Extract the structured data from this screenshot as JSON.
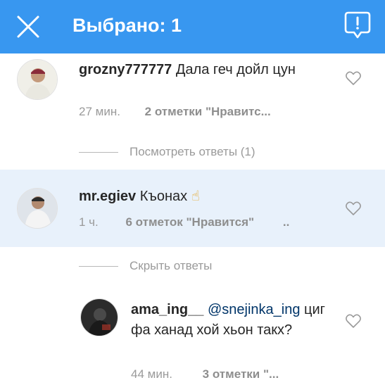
{
  "header": {
    "title": "Выбрано: 1"
  },
  "comments": [
    {
      "username": "grozny777777",
      "text": "Дала геч дойл цун",
      "time": "27 мин.",
      "likes": "2 отметки \"Нравитс...",
      "replies_toggle": "Посмотреть ответы (1)"
    },
    {
      "username": "mr.egiev",
      "text": "Къонах",
      "emoji": "☝",
      "time": "1 ч.",
      "likes": "6 отметок \"Нравится\"",
      "more": "..",
      "replies_toggle": "Скрыть ответы",
      "selected": true
    },
    {
      "username": "ama_ing__",
      "mention": "@snejinka_ing",
      "text": "циг фа ханад хой хьон такх?",
      "time": "44 мин.",
      "likes": "3 отметки \"..."
    }
  ],
  "colors": {
    "accent": "#3897f0",
    "selected_bg": "#e8f1fb",
    "mention": "#003569",
    "meta": "#9a9a9a"
  },
  "icons": {
    "close": "close-icon",
    "report": "report-icon",
    "heart": "heart-icon"
  }
}
